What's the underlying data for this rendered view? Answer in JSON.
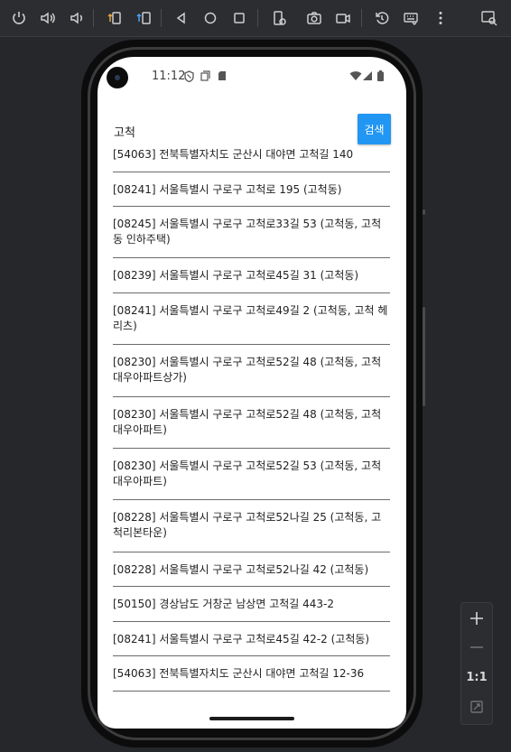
{
  "status_bar": {
    "time": "11:12"
  },
  "search": {
    "value": "고척",
    "button_label": "검색"
  },
  "results": [
    "[54063] 전북특별자치도 군산시 대야면 고척길 140",
    "[08241] 서울특별시 구로구 고척로 195 (고척동)",
    "[08245] 서울특별시 구로구 고척로33길 53 (고척동, 고척동 인하주택)",
    "[08239] 서울특별시 구로구 고척로45길 31 (고척동)",
    "[08241] 서울특별시 구로구 고척로49길 2 (고척동, 고척 헤리츠)",
    "[08230] 서울특별시 구로구 고척로52길 48 (고척동, 고척대우아파트상가)",
    "[08230] 서울특별시 구로구 고척로52길 48 (고척동, 고척대우아파트)",
    "[08230] 서울특별시 구로구 고척로52길 53 (고척동, 고척대우아파트)",
    "[08228] 서울특별시 구로구 고척로52나길 25 (고척동, 고척리본타운)",
    "[08228] 서울특별시 구로구 고척로52나길 42 (고척동)",
    "[50150] 경상남도 거창군 남상면 고척길 443-2",
    "[08241] 서울특별시 구로구 고척로45길 42-2 (고척동)",
    "[54063] 전북특별자치도 군산시 대야면 고척길 12-36"
  ],
  "zoom": {
    "reset_label": "1:1"
  },
  "colors": {
    "accent": "#2196f3",
    "toolbar_bg": "#2b2d30",
    "window_bg": "#25272a"
  }
}
